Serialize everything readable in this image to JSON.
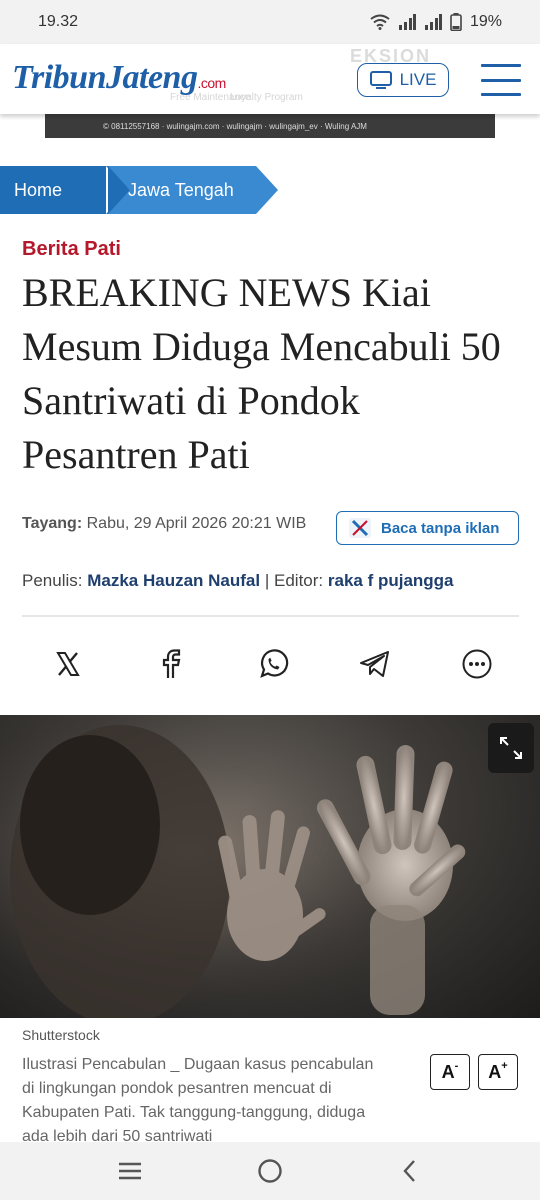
{
  "status": {
    "time": "19.32",
    "battery": "19%"
  },
  "header": {
    "logo_text": "TribunJateng",
    "logo_suffix": ".com",
    "live_label": "LIVE",
    "brand_color": "#1e5fa8"
  },
  "breadcrumb": {
    "home": "Home",
    "section": "Jawa Tengah"
  },
  "article": {
    "kicker": "Berita Pati",
    "headline": "BREAKING NEWS Kiai Mesum Diduga Mencabuli 50 Santriwati di Pondok Pesantren Pati",
    "published_label": "Tayang:",
    "published_value": "Rabu, 29 April 2026 20:21 WIB",
    "adfree_label": "Baca tanpa iklan",
    "writer_label": "Penulis:",
    "writer_name": "Mazka Hauzan Naufal",
    "separator": "|",
    "editor_label": "Editor:",
    "editor_name": "raka f pujangga",
    "image_credit": "Shutterstock",
    "caption": "Ilustrasi Pencabulan _ Dugaan kasus pencabulan di lingkungan pondok pesantren mencuat di Kabupaten Pati. Tak tanggung-tanggung, diduga ada lebih dari 50 santriwati",
    "font_decrease": "A",
    "font_decrease_sup": "-",
    "font_increase": "A",
    "font_increase_sup": "+"
  },
  "share": {
    "icons": [
      "x-icon",
      "facebook-icon",
      "whatsapp-icon",
      "telegram-icon",
      "more-icon"
    ]
  },
  "colors": {
    "kicker": "#b5182b",
    "breadcrumb_home": "#1e6db5",
    "breadcrumb_section": "#3a8ad2",
    "author": "#1f3f6e"
  }
}
